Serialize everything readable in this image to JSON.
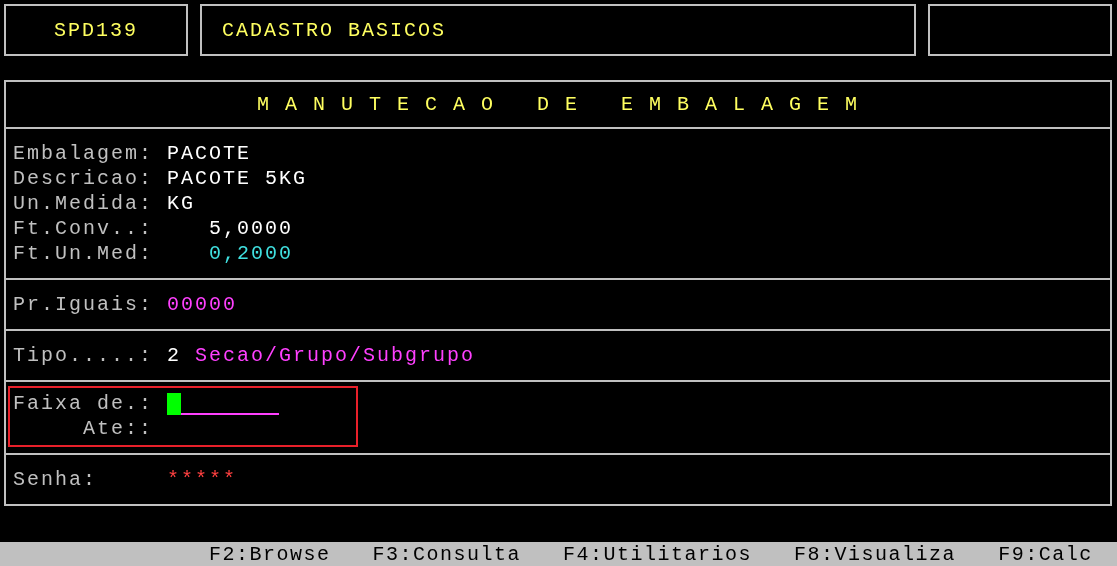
{
  "header": {
    "code": "SPD139",
    "title": "CADASTRO BASICOS"
  },
  "form": {
    "title": "M A N U T E C A O   D E   E M B A L A G E M",
    "sections": [
      {
        "kind": "fields",
        "fields": [
          {
            "kind": "text",
            "label": "Embalagem:",
            "value": "PACOTE",
            "color": "#ffffff"
          },
          {
            "kind": "text",
            "label": "Descricao:",
            "value": "PACOTE 5KG",
            "color": "#ffffff"
          },
          {
            "kind": "text",
            "label": "Un.Medida:",
            "value": "KG",
            "color": "#ffffff"
          },
          {
            "kind": "number",
            "label": "Ft.Conv..:",
            "value": "5,0000",
            "color": "#ffffff"
          },
          {
            "kind": "number",
            "label": "Ft.Un.Med:",
            "value": "0,2000",
            "color": "#40e0e0"
          }
        ]
      },
      {
        "kind": "fields",
        "fields": [
          {
            "kind": "text",
            "label": "Pr.Iguais:",
            "value": "00000",
            "color": "#ff40ff"
          }
        ]
      },
      {
        "kind": "fields",
        "fields": [
          {
            "kind": "text",
            "label": "Tipo.....:",
            "value": "2",
            "note": "Secao/Grupo/Subgrupo",
            "color": "#ffffff"
          }
        ]
      },
      {
        "kind": "range",
        "highlighted": true,
        "fields": [
          {
            "kind": "input",
            "label": "Faixa de.:",
            "focused": true
          },
          {
            "kind": "input",
            "label": "Ate::",
            "focused": false
          }
        ]
      },
      {
        "kind": "fields",
        "fields": [
          {
            "kind": "text",
            "label": "Senha:",
            "value": "*****",
            "color": "#ff4040"
          }
        ]
      }
    ]
  },
  "function_keys": [
    "F2:Browse",
    "F3:Consulta",
    "F4:Utilitarios",
    "F8:Visualiza",
    "F9:Calc"
  ]
}
